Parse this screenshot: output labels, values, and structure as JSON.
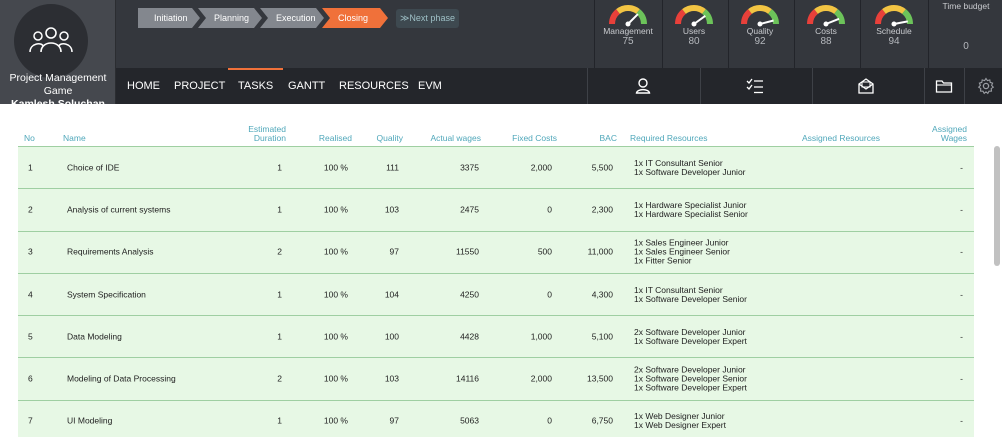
{
  "app": {
    "title_line1": "Project Management Game",
    "title_line2": "Kamlesh Soluchan"
  },
  "phases": [
    {
      "label": "Initiation",
      "state": "done"
    },
    {
      "label": "Planning",
      "state": "done"
    },
    {
      "label": "Execution",
      "state": "done"
    },
    {
      "label": "Closing",
      "state": "active"
    }
  ],
  "next_phase": {
    "label": "≫Next phase"
  },
  "gauges": [
    {
      "label": "Management",
      "value": "75"
    },
    {
      "label": "Users",
      "value": "80"
    },
    {
      "label": "Quality",
      "value": "92"
    },
    {
      "label": "Costs",
      "value": "88"
    },
    {
      "label": "Schedule",
      "value": "94"
    }
  ],
  "time_budget": {
    "label": "Time budget",
    "value": "0"
  },
  "nav": {
    "tabs": [
      "HOME",
      "PROJECT",
      "TASKS",
      "GANTT",
      "RESOURCES",
      "EVM"
    ],
    "active_tab": "TASKS",
    "icons": [
      "user-icon",
      "checklist-icon",
      "mail-icon",
      "folder-icon",
      "gear-icon"
    ]
  },
  "colors": {
    "accent": "#f0713a",
    "header_text": "#4fa7ba",
    "row_bg": "#e7f8e5",
    "row_border": "#9fcfa2",
    "topbar": "#34373d",
    "navbar": "#24262b"
  },
  "table": {
    "headers": {
      "no": "No",
      "name": "Name",
      "estimated_duration_1": "Estimated",
      "estimated_duration_2": "Duration",
      "realised": "Realised",
      "quality": "Quality",
      "actual_wages": "Actual wages",
      "fixed_costs": "Fixed Costs",
      "bac": "BAC",
      "required_resources": "Required Resources",
      "assigned_resources": "Assigned Resources",
      "assigned_wages_1": "Assigned",
      "assigned_wages_2": "Wages"
    },
    "rows": [
      {
        "no": "1",
        "name": "Choice of IDE",
        "duration": "1",
        "realised": "100 %",
        "quality": "111",
        "wages": "3375",
        "fixed": "2,000",
        "bac": "5,500",
        "resources": [
          "1x IT Consultant Senior",
          "1x Software Developer Junior"
        ],
        "assigned_wages": "-"
      },
      {
        "no": "2",
        "name": "Analysis of current systems",
        "duration": "1",
        "realised": "100 %",
        "quality": "103",
        "wages": "2475",
        "fixed": "0",
        "bac": "2,300",
        "resources": [
          "1x Hardware Specialist Junior",
          "1x Hardware Specialist Senior"
        ],
        "assigned_wages": "-"
      },
      {
        "no": "3",
        "name": "Requirements Analysis",
        "duration": "2",
        "realised": "100 %",
        "quality": "97",
        "wages": "11550",
        "fixed": "500",
        "bac": "11,000",
        "resources": [
          "1x Sales Engineer Junior",
          "1x Sales Engineer Senior",
          "1x Fitter Senior"
        ],
        "assigned_wages": "-"
      },
      {
        "no": "4",
        "name": "System Specification",
        "duration": "1",
        "realised": "100 %",
        "quality": "104",
        "wages": "4250",
        "fixed": "0",
        "bac": "4,300",
        "resources": [
          "1x IT Consultant Senior",
          "1x Software Developer Senior"
        ],
        "assigned_wages": "-"
      },
      {
        "no": "5",
        "name": "Data Modeling",
        "duration": "1",
        "realised": "100 %",
        "quality": "100",
        "wages": "4428",
        "fixed": "1,000",
        "bac": "5,100",
        "resources": [
          "2x Software Developer Junior",
          "1x Software Developer Expert"
        ],
        "assigned_wages": "-"
      },
      {
        "no": "6",
        "name": "Modeling of Data Processing",
        "duration": "2",
        "realised": "100 %",
        "quality": "103",
        "wages": "14116",
        "fixed": "2,000",
        "bac": "13,500",
        "resources": [
          "2x Software Developer Junior",
          "1x Software Developer Senior",
          "1x Software Developer Expert"
        ],
        "assigned_wages": "-"
      },
      {
        "no": "7",
        "name": "UI Modeling",
        "duration": "1",
        "realised": "100 %",
        "quality": "97",
        "wages": "5063",
        "fixed": "0",
        "bac": "6,750",
        "resources": [
          "1x Web Designer Junior",
          "1x Web Designer Expert"
        ],
        "assigned_wages": "-"
      }
    ]
  }
}
